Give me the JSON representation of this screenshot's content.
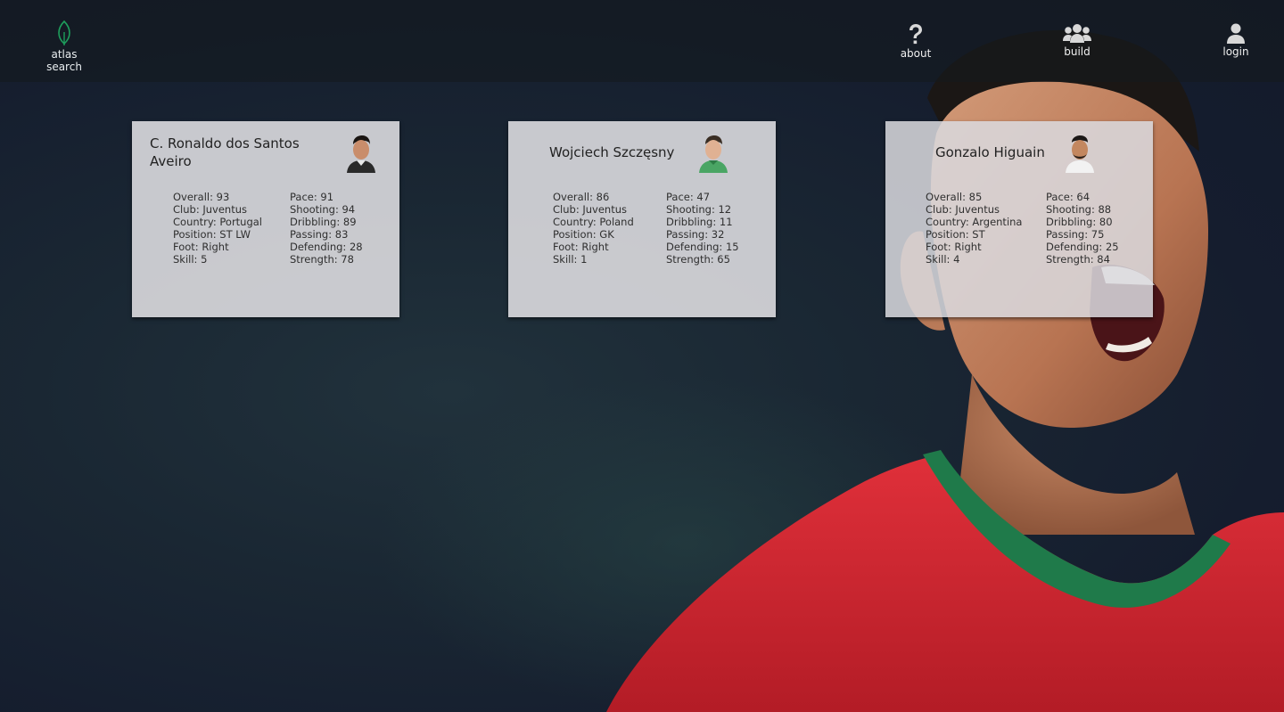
{
  "brand": {
    "label": "atlas search",
    "icon": "leaf-icon",
    "accent": "#1e9e5c"
  },
  "nav": {
    "about": {
      "label": "about",
      "icon": "question-icon"
    },
    "build": {
      "label": "build",
      "icon": "users-icon"
    },
    "login": {
      "label": "login",
      "icon": "user-icon"
    }
  },
  "players": [
    {
      "name": "C. Ronaldo dos Santos Aveiro",
      "left": [
        "Overall: 93",
        "Club: Juventus",
        "Country: Portugal",
        "Position: ST LW",
        "Foot: Right",
        "Skill: 5"
      ],
      "right": [
        "Pace: 91",
        "Shooting: 94",
        "Dribbling: 89",
        "Passing: 83",
        "Defending: 28",
        "Strength: 78"
      ]
    },
    {
      "name": "Wojciech Szczęsny",
      "left": [
        "Overall: 86",
        "Club: Juventus",
        "Country: Poland",
        "Position: GK",
        "Foot: Right",
        "Skill: 1"
      ],
      "right": [
        "Pace: 47",
        "Shooting: 12",
        "Dribbling: 11",
        "Passing: 32",
        "Defending: 15",
        "Strength: 65"
      ]
    },
    {
      "name": "Gonzalo Higuain",
      "left": [
        "Overall: 85",
        "Club: Juventus",
        "Country: Argentina",
        "Position: ST",
        "Foot: Right",
        "Skill: 4"
      ],
      "right": [
        "Pace: 64",
        "Shooting: 88",
        "Dribbling: 80",
        "Passing: 75",
        "Defending: 25",
        "Strength: 84"
      ]
    }
  ],
  "colors": {
    "background": "#171f2e",
    "card": "#d6d6da",
    "jersey": "#d8262c",
    "collar": "#1f7a4a"
  }
}
